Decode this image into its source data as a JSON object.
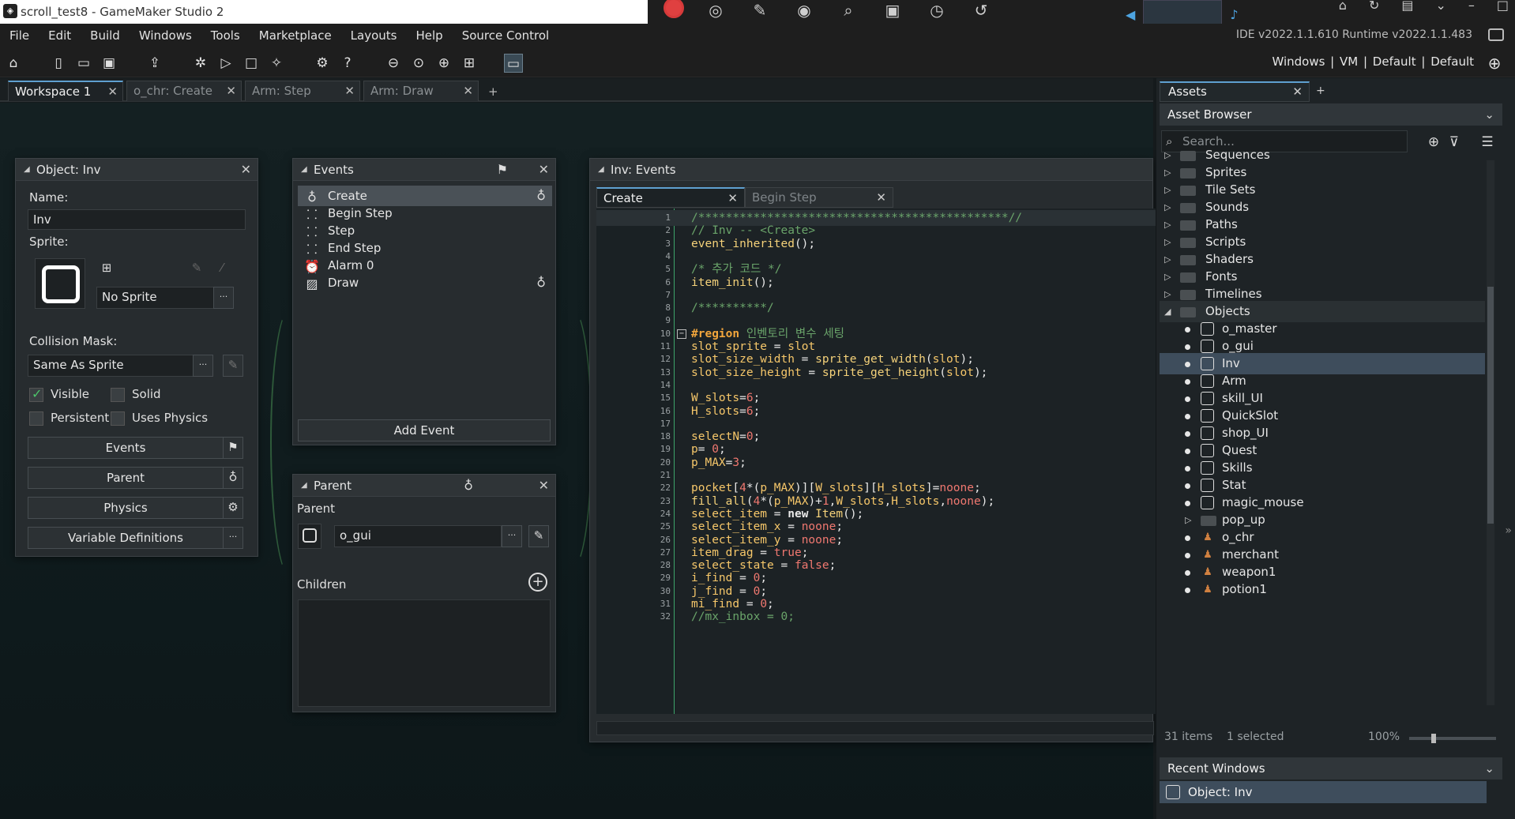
{
  "window": {
    "title": "scroll_test8 - GameMaker Studio 2",
    "ide_version": "IDE v2022.1.1.610  Runtime v2022.1.1.483"
  },
  "menu": [
    "File",
    "Edit",
    "Build",
    "Windows",
    "Tools",
    "Marketplace",
    "Layouts",
    "Help",
    "Source Control"
  ],
  "target_bar": "Windows | VM | Default | Default",
  "workspace_tabs": [
    {
      "label": "Workspace 1",
      "active": true
    },
    {
      "label": "o_chr: Create",
      "active": false
    },
    {
      "label": "Arm: Step",
      "active": false
    },
    {
      "label": "Arm: Draw",
      "active": false
    }
  ],
  "object_panel": {
    "title": "Object: Inv",
    "name_label": "Name:",
    "name_value": "Inv",
    "sprite_label": "Sprite:",
    "sprite_value": "No Sprite",
    "collision_label": "Collision Mask:",
    "collision_value": "Same As Sprite",
    "visible_label": "Visible",
    "visible_checked": true,
    "solid_label": "Solid",
    "solid_checked": false,
    "persistent_label": "Persistent",
    "persistent_checked": false,
    "physics_label": "Uses Physics",
    "physics_checked": false,
    "events_btn": "Events",
    "parent_btn": "Parent",
    "physics_btn": "Physics",
    "vardef_btn": "Variable Definitions",
    "ellipsis": "···"
  },
  "events_panel": {
    "title": "Events",
    "events": [
      {
        "label": "Create",
        "icon": "bulb-icon",
        "glyph": "♁",
        "inherited": true,
        "selected": true
      },
      {
        "label": "Begin Step",
        "icon": "footsteps-icon",
        "glyph": "⸬",
        "inherited": false,
        "selected": false
      },
      {
        "label": "Step",
        "icon": "footsteps-icon",
        "glyph": "⸬",
        "inherited": false,
        "selected": false
      },
      {
        "label": "End Step",
        "icon": "footsteps-icon",
        "glyph": "⸬",
        "inherited": false,
        "selected": false
      },
      {
        "label": "Alarm 0",
        "icon": "alarm-clock-icon",
        "glyph": "⏰",
        "inherited": false,
        "selected": false
      },
      {
        "label": "Draw",
        "icon": "draw-picture-icon",
        "glyph": "▨",
        "inherited": true,
        "selected": false
      }
    ],
    "add_event": "Add Event"
  },
  "parent_panel": {
    "title": "Parent",
    "parent_label": "Parent",
    "parent_value": "o_gui",
    "children_label": "Children",
    "ellipsis": "···"
  },
  "code_panel": {
    "title": "Inv: Events",
    "tabs": [
      {
        "label": "Create",
        "active": true
      },
      {
        "label": "Begin Step",
        "active": false
      }
    ],
    "lines": [
      {
        "n": "1",
        "html": "<span class='c-com'>/*********************************************//</span>"
      },
      {
        "n": "2",
        "html": "<span class='c-com'>// Inv -- &lt;Create&gt;</span>"
      },
      {
        "n": "3",
        "html": "<span class='c-fn'>event_inherited</span>();"
      },
      {
        "n": "4",
        "html": ""
      },
      {
        "n": "5",
        "html": "<span class='c-com'>/* 추가 코드 */</span>"
      },
      {
        "n": "6",
        "html": "<span class='c-fn'>item_init</span>();"
      },
      {
        "n": "7",
        "html": ""
      },
      {
        "n": "8",
        "html": "<span class='c-com'>/**********/</span>"
      },
      {
        "n": "9",
        "html": ""
      },
      {
        "n": "10",
        "html": "<span class='c-reg'>#region</span> <span class='c-hangul'>인벤토리 변수 세팅</span>"
      },
      {
        "n": "11",
        "html": "<span class='c-var'>slot_sprite</span> = <span class='c-var'>slot</span>"
      },
      {
        "n": "12",
        "html": "<span class='c-var'>slot_size_width</span> = <span class='c-fn'>sprite_get_width</span>(<span class='c-var'>slot</span>);"
      },
      {
        "n": "13",
        "html": "<span class='c-var'>slot_size_height</span> = <span class='c-fn'>sprite_get_height</span>(<span class='c-var'>slot</span>);"
      },
      {
        "n": "14",
        "html": ""
      },
      {
        "n": "15",
        "html": "<span class='c-var'>W_slots</span>=<span class='c-num'>6</span>;"
      },
      {
        "n": "16",
        "html": "<span class='c-var'>H_slots</span>=<span class='c-num'>6</span>;"
      },
      {
        "n": "17",
        "html": ""
      },
      {
        "n": "18",
        "html": "<span class='c-var'>selectN</span>=<span class='c-num'>0</span>;"
      },
      {
        "n": "19",
        "html": "<span class='c-var'>p</span>= <span class='c-num'>0</span>;"
      },
      {
        "n": "20",
        "html": "<span class='c-var'>p_MAX</span>=<span class='c-num'>3</span>;"
      },
      {
        "n": "21",
        "html": ""
      },
      {
        "n": "22",
        "html": "<span class='c-var'>pocket</span>[<span class='c-num'>4</span>*(<span class='c-var'>p_MAX</span>)][<span class='c-var'>W_slots</span>][<span class='c-var'>H_slots</span>]=<span class='c-const'>noone</span>;"
      },
      {
        "n": "23",
        "html": "<span class='c-fn'>fill_all</span>(<span class='c-num'>4</span>*(<span class='c-var'>p_MAX</span>)+<span class='c-num'>1</span>,<span class='c-var'>W_slots</span>,<span class='c-var'>H_slots</span>,<span class='c-const'>noone</span>);"
      },
      {
        "n": "24",
        "html": "<span class='c-var'>select_item</span> = <span class='c-kw2'>new</span> <span class='c-fn'>Item</span>();"
      },
      {
        "n": "25",
        "html": "<span class='c-var'>select_item_x</span> = <span class='c-const'>noone</span>;"
      },
      {
        "n": "26",
        "html": "<span class='c-var'>select_item_y</span> = <span class='c-const'>noone</span>;"
      },
      {
        "n": "27",
        "html": "<span class='c-var'>item_drag</span> = <span class='c-const'>true</span>;"
      },
      {
        "n": "28",
        "html": "<span class='c-var'>select_state</span> = <span class='c-const'>false</span>;"
      },
      {
        "n": "29",
        "html": "<span class='c-var'>i_find</span> = <span class='c-num'>0</span>;"
      },
      {
        "n": "30",
        "html": "<span class='c-var'>j_find</span> = <span class='c-num'>0</span>;"
      },
      {
        "n": "31",
        "html": "<span class='c-var'>mi_find</span> = <span class='c-num'>0</span>;"
      },
      {
        "n": "32",
        "html": "<span class='c-com'>//mx_inbox = 0;</span>"
      }
    ]
  },
  "assets": {
    "tab": "Assets",
    "header": "Asset Browser",
    "search_placeholder": "Search...",
    "tree": [
      {
        "label": "Sequences",
        "kind": "group",
        "expanded": false,
        "partial": true
      },
      {
        "label": "Sprites",
        "kind": "group",
        "expanded": false
      },
      {
        "label": "Tile Sets",
        "kind": "group",
        "expanded": false
      },
      {
        "label": "Sounds",
        "kind": "group",
        "expanded": false
      },
      {
        "label": "Paths",
        "kind": "group",
        "expanded": false
      },
      {
        "label": "Scripts",
        "kind": "group",
        "expanded": false
      },
      {
        "label": "Shaders",
        "kind": "group",
        "expanded": false
      },
      {
        "label": "Fonts",
        "kind": "group",
        "expanded": false
      },
      {
        "label": "Timelines",
        "kind": "group",
        "expanded": false
      },
      {
        "label": "Objects",
        "kind": "group",
        "expanded": true
      },
      {
        "label": "o_master",
        "kind": "object"
      },
      {
        "label": "o_gui",
        "kind": "object"
      },
      {
        "label": "Inv",
        "kind": "object",
        "selected": true
      },
      {
        "label": "Arm",
        "kind": "object"
      },
      {
        "label": "skill_UI",
        "kind": "object"
      },
      {
        "label": "QuickSlot",
        "kind": "object"
      },
      {
        "label": "shop_UI",
        "kind": "object"
      },
      {
        "label": "Quest",
        "kind": "object"
      },
      {
        "label": "Skills",
        "kind": "object"
      },
      {
        "label": "Stat",
        "kind": "object"
      },
      {
        "label": "magic_mouse",
        "kind": "object"
      },
      {
        "label": "pop_up",
        "kind": "subfolder"
      },
      {
        "label": "o_chr",
        "kind": "sprite-object"
      },
      {
        "label": "merchant",
        "kind": "sprite-object"
      },
      {
        "label": "weapon1",
        "kind": "sprite-object"
      },
      {
        "label": "potion1",
        "kind": "sprite-object"
      }
    ],
    "status_items": "31 items",
    "status_selected": "1 selected",
    "zoom": "100%",
    "recent_header": "Recent Windows",
    "recent_item": "Object: Inv"
  }
}
